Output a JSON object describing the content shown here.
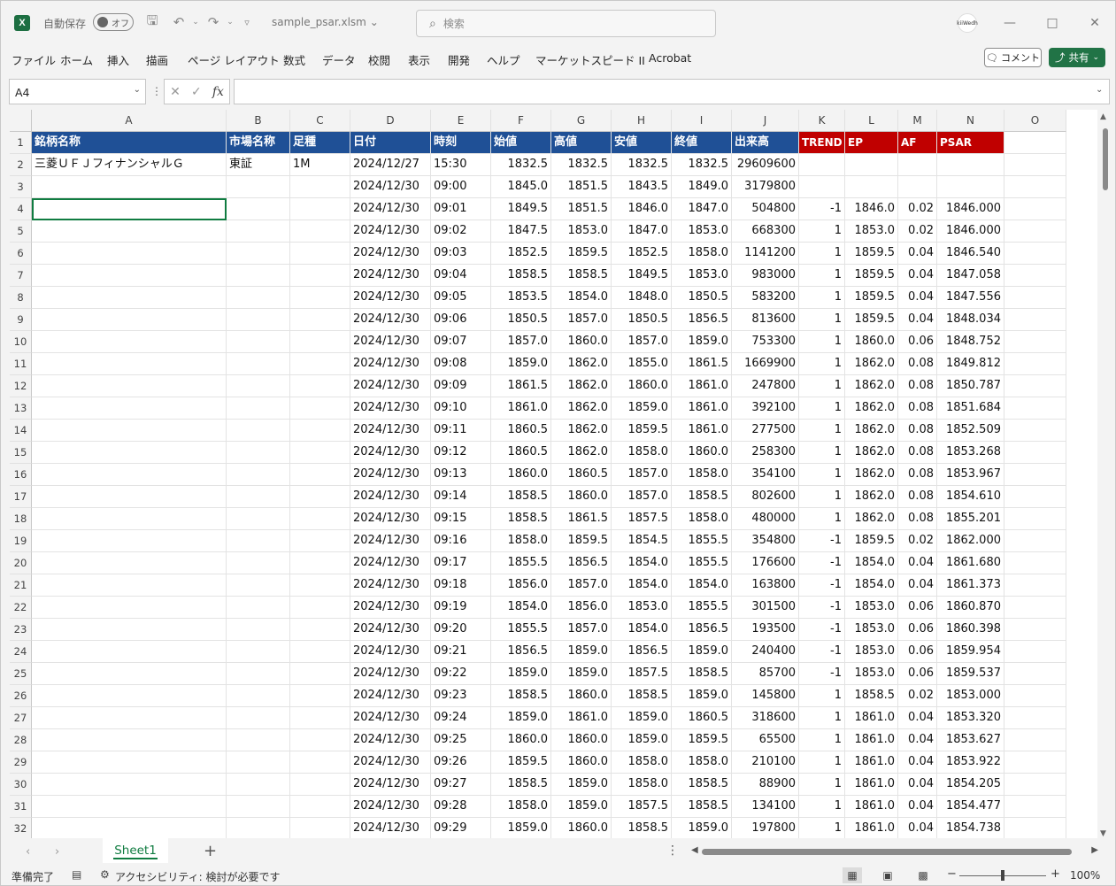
{
  "titlebar": {
    "app_icon": "X",
    "autosave_label": "自動保存",
    "toggle_label": "オフ",
    "filename": "sample_psar.xlsm",
    "search_placeholder": "検索",
    "avatar_text": "kiiWedh"
  },
  "menu": [
    "ファイル",
    "ホーム",
    "挿入",
    "描画",
    "ページ レイアウト",
    "数式",
    "データ",
    "校閲",
    "表示",
    "開発",
    "ヘルプ",
    "マーケットスピード II",
    "Acrobat"
  ],
  "buttons": {
    "comment": "コメント",
    "share": "共有"
  },
  "formula_bar": {
    "name_box": "A4",
    "fx_label": "fx",
    "formula": ""
  },
  "columns": [
    "A",
    "B",
    "C",
    "D",
    "E",
    "F",
    "G",
    "H",
    "I",
    "J",
    "K",
    "L",
    "M",
    "N",
    "O"
  ],
  "header_row": [
    "銘柄名称",
    "市場名称",
    "足種",
    "日付",
    "時刻",
    "始値",
    "高値",
    "安値",
    "終値",
    "出来高",
    "TREND",
    "EP",
    "AF",
    "PSAR",
    ""
  ],
  "rows": [
    [
      "三菱ＵＦＪフィナンシャルＧ",
      "東証",
      "1M",
      "2024/12/27",
      "15:30",
      "1832.5",
      "1832.5",
      "1832.5",
      "1832.5",
      "29609600",
      "",
      "",
      "",
      "",
      ""
    ],
    [
      "",
      "",
      "",
      "2024/12/30",
      "09:00",
      "1845.0",
      "1851.5",
      "1843.5",
      "1849.0",
      "3179800",
      "",
      "",
      "",
      "",
      ""
    ],
    [
      "",
      "",
      "",
      "2024/12/30",
      "09:01",
      "1849.5",
      "1851.5",
      "1846.0",
      "1847.0",
      "504800",
      "-1",
      "1846.0",
      "0.02",
      "1846.000",
      ""
    ],
    [
      "",
      "",
      "",
      "2024/12/30",
      "09:02",
      "1847.5",
      "1853.0",
      "1847.0",
      "1853.0",
      "668300",
      "1",
      "1853.0",
      "0.02",
      "1846.000",
      ""
    ],
    [
      "",
      "",
      "",
      "2024/12/30",
      "09:03",
      "1852.5",
      "1859.5",
      "1852.5",
      "1858.0",
      "1141200",
      "1",
      "1859.5",
      "0.04",
      "1846.540",
      ""
    ],
    [
      "",
      "",
      "",
      "2024/12/30",
      "09:04",
      "1858.5",
      "1858.5",
      "1849.5",
      "1853.0",
      "983000",
      "1",
      "1859.5",
      "0.04",
      "1847.058",
      ""
    ],
    [
      "",
      "",
      "",
      "2024/12/30",
      "09:05",
      "1853.5",
      "1854.0",
      "1848.0",
      "1850.5",
      "583200",
      "1",
      "1859.5",
      "0.04",
      "1847.556",
      ""
    ],
    [
      "",
      "",
      "",
      "2024/12/30",
      "09:06",
      "1850.5",
      "1857.0",
      "1850.5",
      "1856.5",
      "813600",
      "1",
      "1859.5",
      "0.04",
      "1848.034",
      ""
    ],
    [
      "",
      "",
      "",
      "2024/12/30",
      "09:07",
      "1857.0",
      "1860.0",
      "1857.0",
      "1859.0",
      "753300",
      "1",
      "1860.0",
      "0.06",
      "1848.752",
      ""
    ],
    [
      "",
      "",
      "",
      "2024/12/30",
      "09:08",
      "1859.0",
      "1862.0",
      "1855.0",
      "1861.5",
      "1669900",
      "1",
      "1862.0",
      "0.08",
      "1849.812",
      ""
    ],
    [
      "",
      "",
      "",
      "2024/12/30",
      "09:09",
      "1861.5",
      "1862.0",
      "1860.0",
      "1861.0",
      "247800",
      "1",
      "1862.0",
      "0.08",
      "1850.787",
      ""
    ],
    [
      "",
      "",
      "",
      "2024/12/30",
      "09:10",
      "1861.0",
      "1862.0",
      "1859.0",
      "1861.0",
      "392100",
      "1",
      "1862.0",
      "0.08",
      "1851.684",
      ""
    ],
    [
      "",
      "",
      "",
      "2024/12/30",
      "09:11",
      "1860.5",
      "1862.0",
      "1859.5",
      "1861.0",
      "277500",
      "1",
      "1862.0",
      "0.08",
      "1852.509",
      ""
    ],
    [
      "",
      "",
      "",
      "2024/12/30",
      "09:12",
      "1860.5",
      "1862.0",
      "1858.0",
      "1860.0",
      "258300",
      "1",
      "1862.0",
      "0.08",
      "1853.268",
      ""
    ],
    [
      "",
      "",
      "",
      "2024/12/30",
      "09:13",
      "1860.0",
      "1860.5",
      "1857.0",
      "1858.0",
      "354100",
      "1",
      "1862.0",
      "0.08",
      "1853.967",
      ""
    ],
    [
      "",
      "",
      "",
      "2024/12/30",
      "09:14",
      "1858.5",
      "1860.0",
      "1857.0",
      "1858.5",
      "802600",
      "1",
      "1862.0",
      "0.08",
      "1854.610",
      ""
    ],
    [
      "",
      "",
      "",
      "2024/12/30",
      "09:15",
      "1858.5",
      "1861.5",
      "1857.5",
      "1858.0",
      "480000",
      "1",
      "1862.0",
      "0.08",
      "1855.201",
      ""
    ],
    [
      "",
      "",
      "",
      "2024/12/30",
      "09:16",
      "1858.0",
      "1859.5",
      "1854.5",
      "1855.5",
      "354800",
      "-1",
      "1859.5",
      "0.02",
      "1862.000",
      ""
    ],
    [
      "",
      "",
      "",
      "2024/12/30",
      "09:17",
      "1855.5",
      "1856.5",
      "1854.0",
      "1855.5",
      "176600",
      "-1",
      "1854.0",
      "0.04",
      "1861.680",
      ""
    ],
    [
      "",
      "",
      "",
      "2024/12/30",
      "09:18",
      "1856.0",
      "1857.0",
      "1854.0",
      "1854.0",
      "163800",
      "-1",
      "1854.0",
      "0.04",
      "1861.373",
      ""
    ],
    [
      "",
      "",
      "",
      "2024/12/30",
      "09:19",
      "1854.0",
      "1856.0",
      "1853.0",
      "1855.5",
      "301500",
      "-1",
      "1853.0",
      "0.06",
      "1860.870",
      ""
    ],
    [
      "",
      "",
      "",
      "2024/12/30",
      "09:20",
      "1855.5",
      "1857.0",
      "1854.0",
      "1856.5",
      "193500",
      "-1",
      "1853.0",
      "0.06",
      "1860.398",
      ""
    ],
    [
      "",
      "",
      "",
      "2024/12/30",
      "09:21",
      "1856.5",
      "1859.0",
      "1856.5",
      "1859.0",
      "240400",
      "-1",
      "1853.0",
      "0.06",
      "1859.954",
      ""
    ],
    [
      "",
      "",
      "",
      "2024/12/30",
      "09:22",
      "1859.0",
      "1859.0",
      "1857.5",
      "1858.5",
      "85700",
      "-1",
      "1853.0",
      "0.06",
      "1859.537",
      ""
    ],
    [
      "",
      "",
      "",
      "2024/12/30",
      "09:23",
      "1858.5",
      "1860.0",
      "1858.5",
      "1859.0",
      "145800",
      "1",
      "1858.5",
      "0.02",
      "1853.000",
      ""
    ],
    [
      "",
      "",
      "",
      "2024/12/30",
      "09:24",
      "1859.0",
      "1861.0",
      "1859.0",
      "1860.5",
      "318600",
      "1",
      "1861.0",
      "0.04",
      "1853.320",
      ""
    ],
    [
      "",
      "",
      "",
      "2024/12/30",
      "09:25",
      "1860.0",
      "1860.0",
      "1859.0",
      "1859.5",
      "65500",
      "1",
      "1861.0",
      "0.04",
      "1853.627",
      ""
    ],
    [
      "",
      "",
      "",
      "2024/12/30",
      "09:26",
      "1859.5",
      "1860.0",
      "1858.0",
      "1858.0",
      "210100",
      "1",
      "1861.0",
      "0.04",
      "1853.922",
      ""
    ],
    [
      "",
      "",
      "",
      "2024/12/30",
      "09:27",
      "1858.5",
      "1859.0",
      "1858.0",
      "1858.5",
      "88900",
      "1",
      "1861.0",
      "0.04",
      "1854.205",
      ""
    ],
    [
      "",
      "",
      "",
      "2024/12/30",
      "09:28",
      "1858.0",
      "1859.0",
      "1857.5",
      "1858.5",
      "134100",
      "1",
      "1861.0",
      "0.04",
      "1854.477",
      ""
    ],
    [
      "",
      "",
      "",
      "2024/12/30",
      "09:29",
      "1859.0",
      "1860.0",
      "1858.5",
      "1859.0",
      "197800",
      "1",
      "1861.0",
      "0.04",
      "1854.738",
      ""
    ]
  ],
  "sheet_tabs": [
    "Sheet1"
  ],
  "statusbar": {
    "ready": "準備完了",
    "accessibility": "アクセシビリティ: 検討が必要です",
    "zoom": "100%"
  },
  "colors": {
    "header_blue": "#1f5096",
    "header_red": "#c00000",
    "excel_green": "#107c41"
  }
}
